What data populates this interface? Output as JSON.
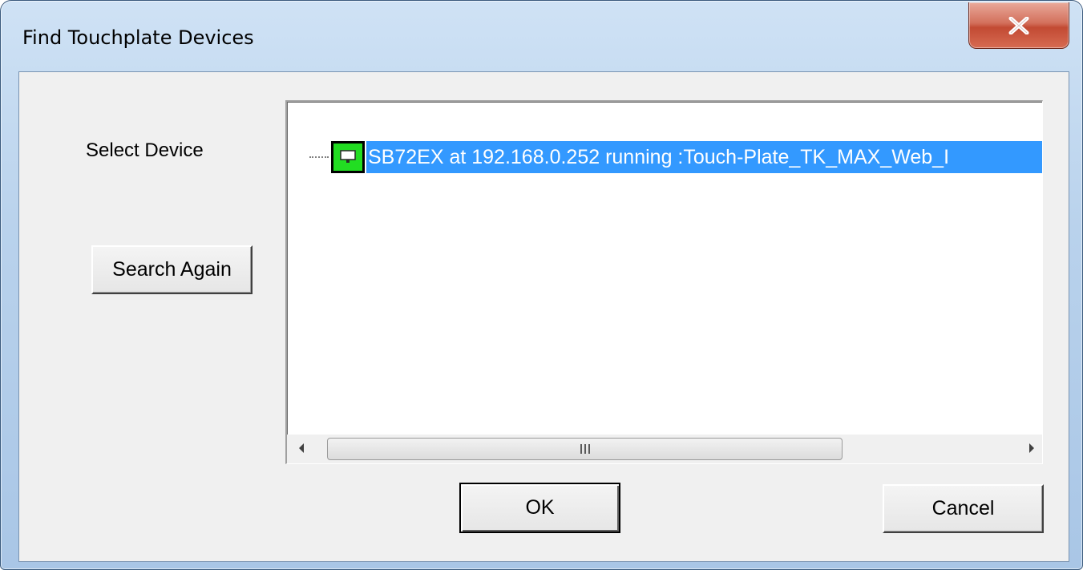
{
  "window": {
    "title": "Find Touchplate Devices"
  },
  "labels": {
    "select_device": "Select Device"
  },
  "buttons": {
    "search_again": "Search Again",
    "ok": "OK",
    "cancel": "Cancel"
  },
  "device_list": {
    "items": [
      {
        "text": "SB72EX  at 192.168.0.252 running :Touch-Plate_TK_MAX_Web_I",
        "selected": true,
        "icon": "network-device-icon"
      }
    ]
  },
  "colors": {
    "selection": "#3399ff",
    "device_icon": "#22dd22",
    "close_button": "#c24a33"
  }
}
